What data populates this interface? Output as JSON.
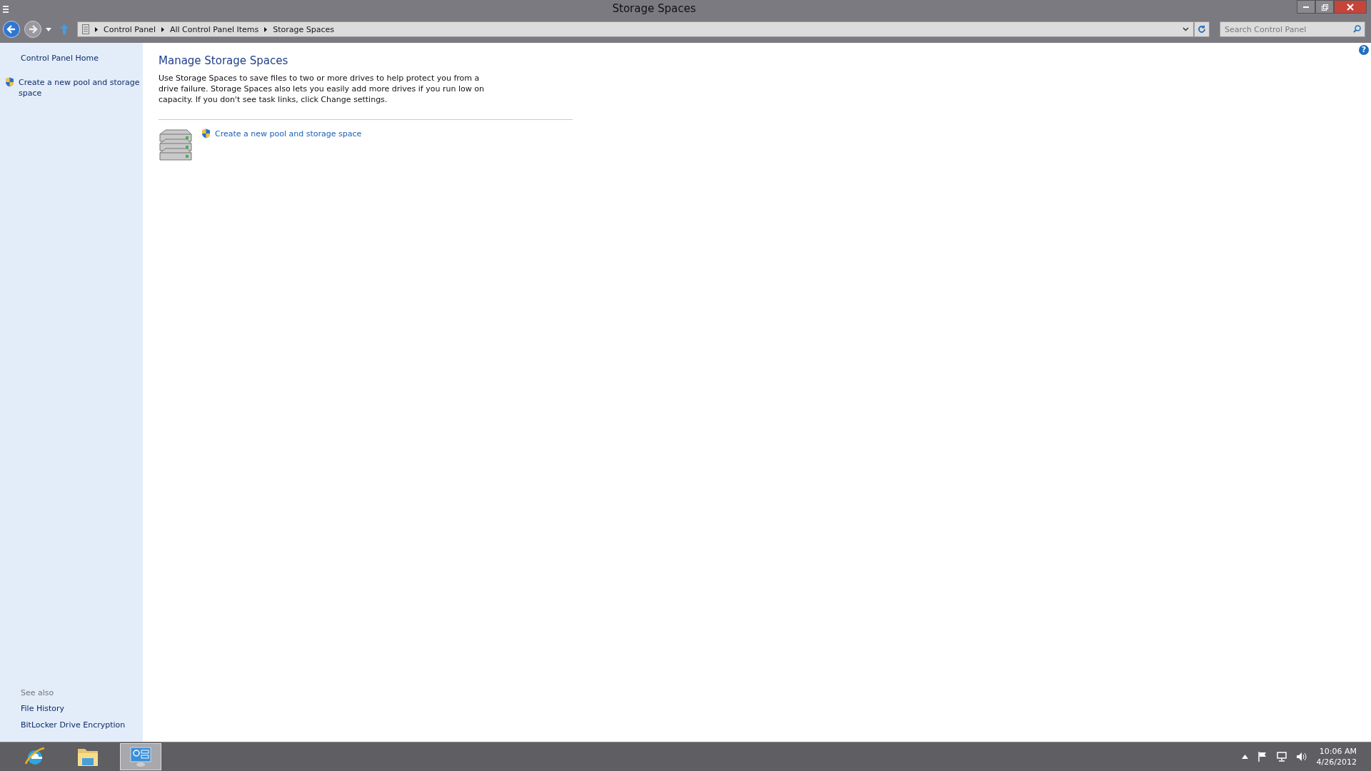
{
  "window": {
    "title": "Storage Spaces"
  },
  "address_bar": {
    "breadcrumbs": [
      "Control Panel",
      "All Control Panel Items",
      "Storage Spaces"
    ]
  },
  "search": {
    "placeholder": "Search Control Panel"
  },
  "sidebar": {
    "home_link": "Control Panel Home",
    "tasks": [
      {
        "label": "Create a new pool and storage space"
      }
    ],
    "see_also_heading": "See also",
    "see_also": [
      "File History",
      "BitLocker Drive Encryption"
    ]
  },
  "content": {
    "heading": "Manage Storage Spaces",
    "description": "Use Storage Spaces to save files to two or more drives to help protect you from a drive failure. Storage Spaces also lets you easily add more drives if you run low on capacity. If you don't see task links, click Change settings.",
    "help": "?",
    "tasks": [
      {
        "label": "Create a new pool and storage space"
      }
    ]
  },
  "taskbar": {
    "apps": [
      {
        "kind": "browser",
        "selected": false
      },
      {
        "kind": "folder",
        "selected": false
      },
      {
        "kind": "control-panel",
        "selected": true
      }
    ],
    "time": "10:06 AM",
    "date": "4/26/2012"
  }
}
